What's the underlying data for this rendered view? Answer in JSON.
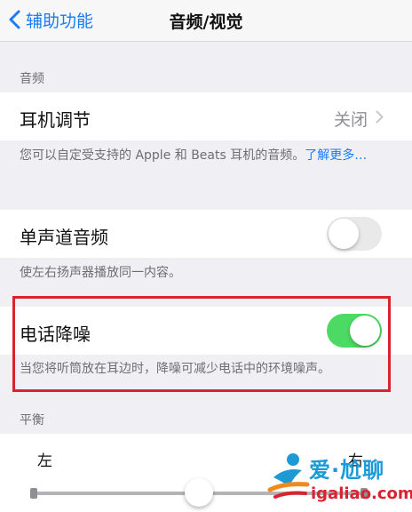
{
  "nav": {
    "back_label": "辅助功能",
    "title": "音频/视觉"
  },
  "audio_section": {
    "header": "音频",
    "headphone": {
      "label": "耳机调节",
      "value": "关闭"
    },
    "headphone_footer_text": "您可以自定受支持的 Apple 和 Beats 耳机的音频。",
    "headphone_footer_link": "了解更多…",
    "mono": {
      "label": "单声道音频",
      "state": "off"
    },
    "mono_footer": "使左右扬声器播放同一内容。",
    "noise_cancel": {
      "label": "电话降噪",
      "state": "on"
    },
    "noise_footer": "当您将听筒放在耳边时，降噪可减少电话中的环境噪声。"
  },
  "balance_section": {
    "header": "平衡",
    "left_label": "左",
    "right_label": "右",
    "value": 0.5
  },
  "watermark": {
    "brand": "爱·尬聊",
    "url": "igaliao.com"
  },
  "colors": {
    "accent": "#1a7cf5",
    "toggle_on": "#4cd964",
    "highlight": "#d9232e"
  }
}
